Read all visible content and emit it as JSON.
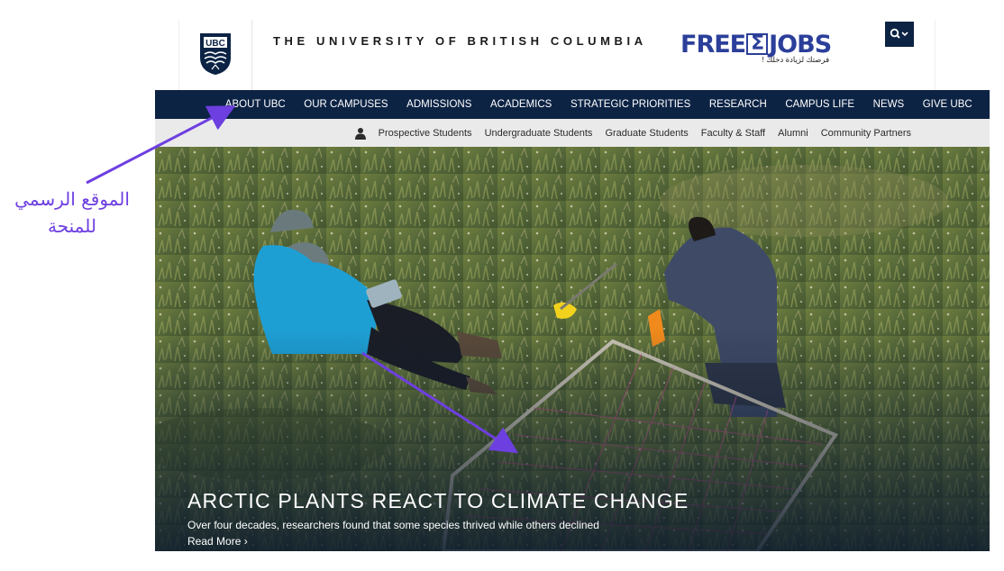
{
  "header": {
    "logo_text": "UBC",
    "university_name": "THE UNIVERSITY OF BRITISH COLUMBIA",
    "watermark_brand": "FREE",
    "watermark_brand_symbol": "Σ",
    "watermark_brand_end": "JOBS",
    "watermark_tagline": "فرصتك لزيادة دخلك !",
    "search_icon": "search-icon"
  },
  "nav": {
    "items": [
      {
        "label": "ABOUT UBC"
      },
      {
        "label": "OUR CAMPUSES"
      },
      {
        "label": "ADMISSIONS"
      },
      {
        "label": "ACADEMICS"
      },
      {
        "label": "STRATEGIC PRIORITIES"
      },
      {
        "label": "RESEARCH"
      },
      {
        "label": "CAMPUS LIFE"
      },
      {
        "label": "NEWS"
      },
      {
        "label": "GIVE UBC"
      }
    ]
  },
  "audience_nav": {
    "icon": "person-icon",
    "items": [
      {
        "label": "Prospective Students"
      },
      {
        "label": "Undergraduate Students"
      },
      {
        "label": "Graduate Students"
      },
      {
        "label": "Faculty & Staff"
      },
      {
        "label": "Alumni"
      },
      {
        "label": "Community Partners"
      }
    ]
  },
  "hero": {
    "title": "ARCTIC PLANTS REACT TO CLIMATE CHANGE",
    "subtitle": "Over four decades, researchers found that some species thrived while others declined",
    "read_more": "Read More ›"
  },
  "annotation": {
    "line1": "الموقع الرسمي",
    "line2": "للمنحة"
  },
  "colors": {
    "navy": "#0c2344",
    "annotation_purple": "#6d3fe0",
    "watermark_blue": "#2b3f9a"
  }
}
